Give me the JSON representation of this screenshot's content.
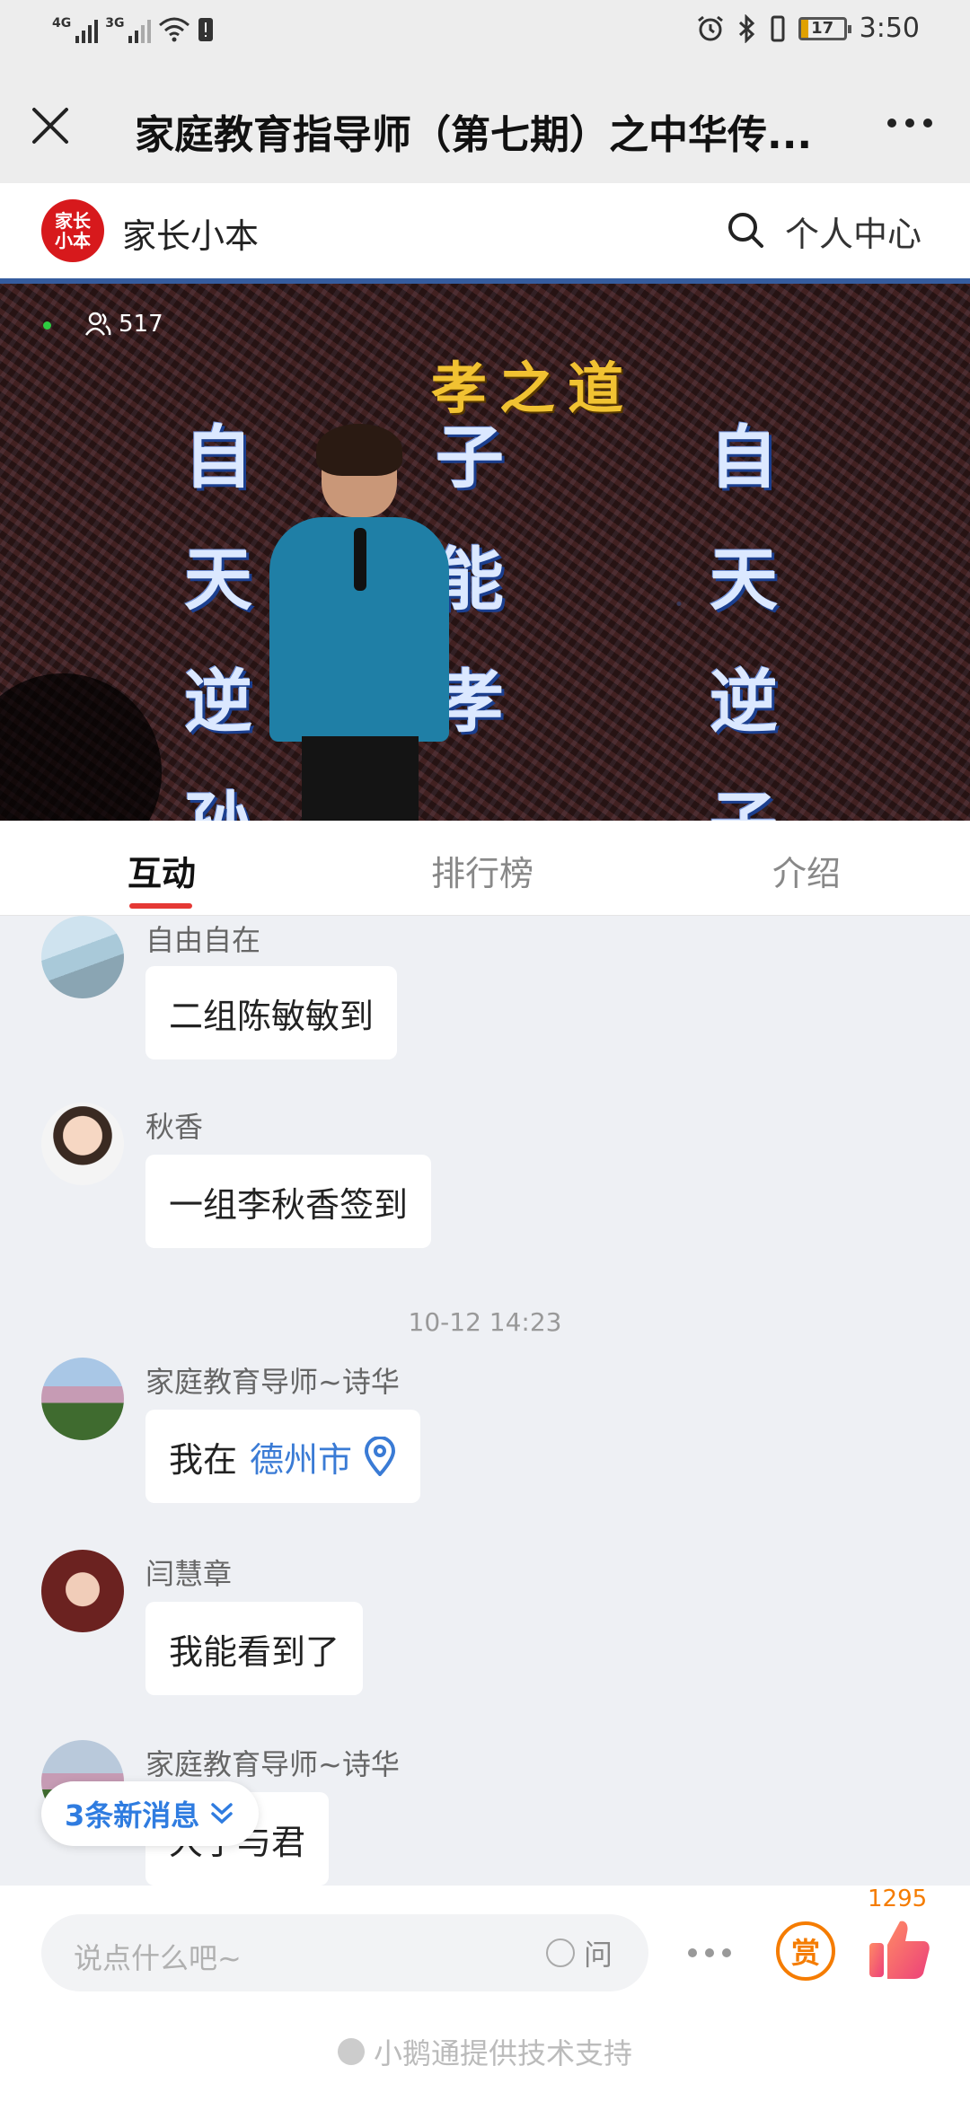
{
  "status_bar": {
    "left_tags": [
      "4G",
      "3G"
    ],
    "time": "3:50",
    "battery": "17"
  },
  "nav": {
    "title": "家庭教育指导师（第七期）之中华传..."
  },
  "shop": {
    "logo_text": "家长小本",
    "name": "家长小本",
    "personal_center": "个人中心"
  },
  "video": {
    "viewer_count": "517",
    "slide_title": "孝之道",
    "columns": [
      [
        "自",
        "天",
        "逆",
        "孙"
      ],
      [
        "子",
        "能",
        "孝"
      ],
      [
        "自",
        "天",
        "逆",
        "子"
      ]
    ]
  },
  "tabs": [
    {
      "label": "互动",
      "active": true
    },
    {
      "label": "排行榜",
      "active": false
    },
    {
      "label": "介绍",
      "active": false
    }
  ],
  "chat": {
    "messages": [
      {
        "sender": "自由自在",
        "text": "二组陈敏敏到"
      },
      {
        "sender": "秋香",
        "text": "一组李秋香签到"
      },
      {
        "timestamp": "10-12 14:23"
      },
      {
        "sender": "家庭教育导师~诗华",
        "text": "我在",
        "location": "德州市"
      },
      {
        "sender": "闫慧章",
        "text": "我能看到了"
      },
      {
        "sender": "家庭教育导师~诗华",
        "text": "大于与君"
      }
    ],
    "new_messages": "3条新消息"
  },
  "bottom": {
    "input_placeholder": "说点什么吧~",
    "ask_label": "问",
    "reward_label": "赏",
    "like_count": "1295",
    "powered_by": "小鹅通提供技术支持"
  },
  "colors": {
    "accent_red": "#e53935",
    "link_blue": "#3a7bd5",
    "reward_orange": "#f57c00"
  }
}
